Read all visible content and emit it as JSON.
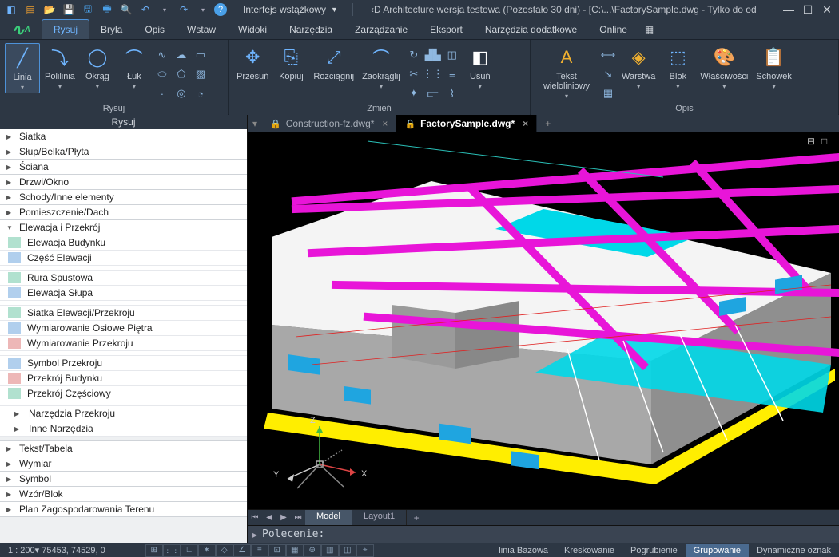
{
  "qat": {
    "interface_combo": "Interfejs wstążkowy"
  },
  "title": "‹D Architecture wersja testowa (Pozostało 30 dni) - [C:\\...\\FactorySample.dwg - Tylko do od",
  "menu": {
    "tabs": [
      "Rysuj",
      "Bryła",
      "Opis",
      "Wstaw",
      "Widoki",
      "Narzędzia",
      "Zarządzanie",
      "Eksport",
      "Narzędzia dodatkowe",
      "Online"
    ],
    "active": 0
  },
  "ribbon": {
    "groups": [
      {
        "label": "Rysuj",
        "big": [
          {
            "t": "Linia"
          },
          {
            "t": "Polilinia"
          },
          {
            "t": "Okrąg"
          },
          {
            "t": "Łuk"
          }
        ]
      },
      {
        "label": "Zmień",
        "big": [
          {
            "t": "Przesuń"
          },
          {
            "t": "Kopiuj"
          },
          {
            "t": "Rozciągnij"
          },
          {
            "t": "Zaokrąglij"
          }
        ],
        "extra": "Usuń"
      },
      {
        "label": "Opis",
        "big": [
          {
            "t": "Tekst wieloliniowy"
          }
        ],
        "tail": [
          "Warstwa",
          "Blok",
          "Właściwości",
          "Schowek"
        ]
      }
    ]
  },
  "palette": {
    "header": "Rysuj",
    "cats": [
      {
        "name": "Siatka",
        "open": false
      },
      {
        "name": "Słup/Belka/Płyta",
        "open": false
      },
      {
        "name": "Ściana",
        "open": false
      },
      {
        "name": "Drzwi/Okno",
        "open": false
      },
      {
        "name": "Schody/Inne elementy",
        "open": false
      },
      {
        "name": "Pomieszczenie/Dach",
        "open": false
      },
      {
        "name": "Elewacja i Przekrój",
        "open": true,
        "items": [
          "Elewacja Budynku",
          "Część Elewacji",
          "",
          "Rura Spustowa",
          "Elewacja Słupa",
          "",
          "Siatka Elewacji/Przekroju",
          "Wymiarowanie Osiowe Piętra",
          "Wymiarowanie Przekroju",
          "",
          "Symbol Przekroju",
          "Przekrój Budynku",
          "Przekrój Częściowy",
          "",
          "Narzędzia Przekroju",
          "Inne Narzędzia"
        ]
      },
      {
        "name": "Tekst/Tabela",
        "open": false
      },
      {
        "name": "Wymiar",
        "open": false
      },
      {
        "name": "Symbol",
        "open": false
      },
      {
        "name": "Wzór/Blok",
        "open": false
      },
      {
        "name": "Plan Zagospodarowania Terenu",
        "open": false
      }
    ]
  },
  "docs": {
    "tabs": [
      {
        "name": "Construction-fz.dwg*",
        "active": false
      },
      {
        "name": "FactorySample.dwg*",
        "active": true
      }
    ]
  },
  "modeltabs": {
    "tabs": [
      "Model",
      "Layout1"
    ],
    "active": 0
  },
  "cmd": {
    "prompt": "Polecenie: "
  },
  "axes": {
    "x": "X",
    "y": "Y",
    "z": "Z"
  },
  "status": {
    "coords": "1 : 200▾  75453, 74529, 0",
    "modes": [
      "linia Bazowa",
      "Kreskowanie",
      "Pogrubienie",
      "Grupowanie",
      "Dynamiczne oznak"
    ],
    "modes_on": 3
  }
}
